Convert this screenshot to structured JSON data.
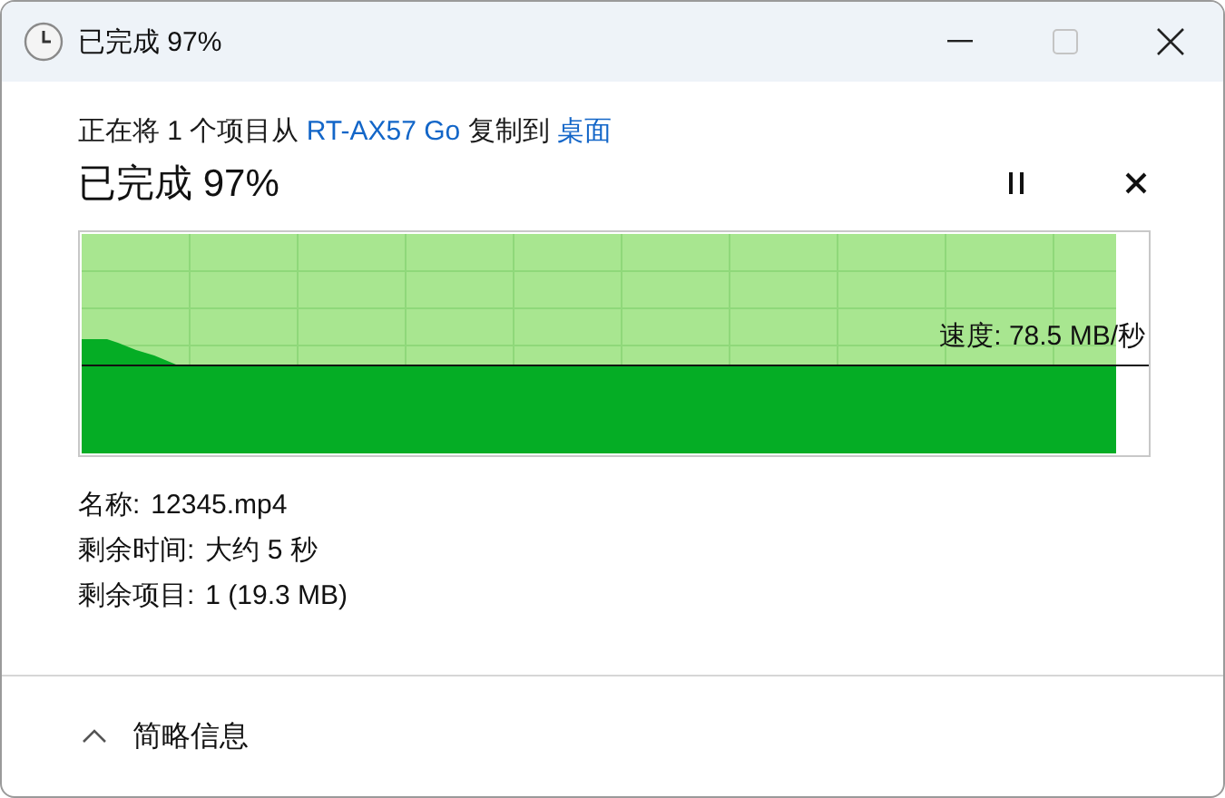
{
  "window": {
    "title": "已完成 97%"
  },
  "copy_status": {
    "parts": [
      {
        "kind": "text",
        "text": "正在将 1 个项目从 "
      },
      {
        "kind": "link",
        "text": "RT-AX57 Go"
      },
      {
        "kind": "text",
        "text": " 复制到 "
      },
      {
        "kind": "link",
        "text": "桌面"
      }
    ]
  },
  "heading": "已完成 97%",
  "progress": {
    "level": 0.97,
    "speed_label": "速度: 78.5 MB/秒"
  },
  "details": [
    {
      "label": "名称:",
      "value": "12345.mp4"
    },
    {
      "label": "剩余时间:",
      "value": "大约 5 秒"
    },
    {
      "label": "剩余项目:",
      "value": "1 (19.3 MB)"
    }
  ],
  "footer": {
    "toggle_label": "简略信息",
    "expanded": true
  }
}
